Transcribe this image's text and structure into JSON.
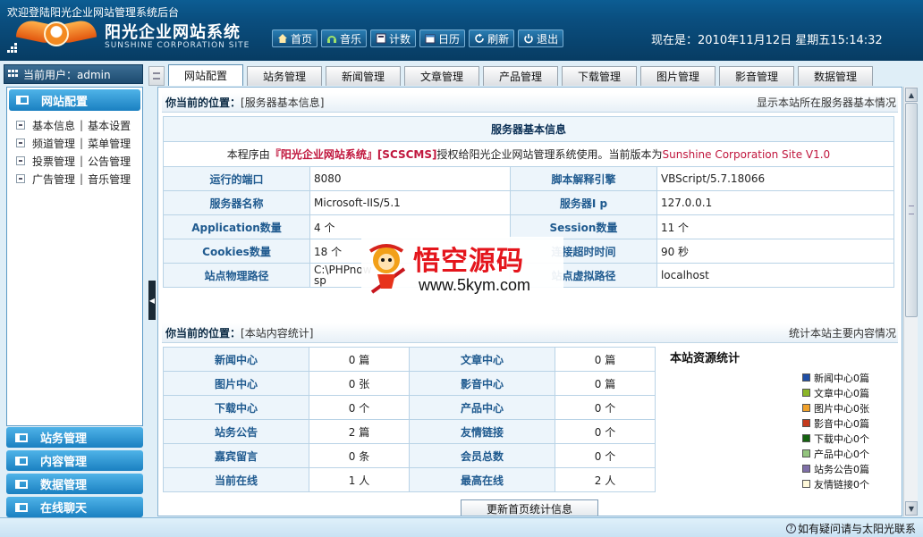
{
  "header": {
    "welcome": "欢迎登陆阳光企业网站管理系统后台",
    "site_title": "阳光企业网站系统",
    "site_subtitle": "SUNSHINE CORPORATION SITE",
    "datetime": "现在是：2010年11月12日 星期五15:14:32",
    "nav": [
      {
        "label": "首页",
        "icon": "home-icon"
      },
      {
        "label": "音乐",
        "icon": "headphones-icon"
      },
      {
        "label": "计数",
        "icon": "counter-icon"
      },
      {
        "label": "日历",
        "icon": "calendar-icon"
      },
      {
        "label": "刷新",
        "icon": "refresh-icon"
      },
      {
        "label": "退出",
        "icon": "power-icon"
      }
    ]
  },
  "sidebar": {
    "current_user": "当前用户：admin",
    "section_title": "网站配置",
    "rows": [
      {
        "a": "基本信息",
        "b": "基本设置"
      },
      {
        "a": "频道管理",
        "b": "菜单管理"
      },
      {
        "a": "投票管理",
        "b": "公告管理"
      },
      {
        "a": "广告管理",
        "b": "音乐管理"
      }
    ],
    "separator": "|",
    "menus": [
      "站务管理",
      "内容管理",
      "数据管理",
      "在线聊天"
    ]
  },
  "tabs": [
    "网站配置",
    "站务管理",
    "新闻管理",
    "文章管理",
    "产品管理",
    "下载管理",
    "图片管理",
    "影音管理",
    "数据管理"
  ],
  "server_section": {
    "location_label": "你当前的位置：",
    "location": "[服务器基本信息]",
    "hint": "显示本站所在服务器基本情况",
    "table_title": "服务器基本信息",
    "notice_prefix": "本程序由",
    "notice_brand": "『阳光企业网站系统』[SCSCMS]",
    "notice_mid": "授权给阳光企业网站管理系统使用。当前版本为",
    "notice_version": "Sunshine Corporation Site V1.0",
    "rows": [
      {
        "l1": "运行的端口",
        "v1": "8080",
        "l2": "脚本解释引擎",
        "v2": "VBScript/5.7.18066"
      },
      {
        "l1": "服务器名称",
        "v1": "Microsoft-IIS/5.1",
        "l2": "服务器I p",
        "v2": "127.0.0.1"
      },
      {
        "l1": "Application数量",
        "v1": "4 个",
        "l2": "Session数量",
        "v2": "11 个"
      },
      {
        "l1": "Cookies数量",
        "v1": "18 个",
        "l2": "连接超时时间",
        "v2": "90 秒"
      },
      {
        "l1": "站点物理路径",
        "v1": "C:\\PHPnow\nsp",
        "l2": "站点虚拟路径",
        "v2": "localhost"
      }
    ]
  },
  "stats_section": {
    "location_label": "你当前的位置：",
    "location": "[本站内容统计]",
    "hint": "统计本站主要内容情况",
    "rows": [
      {
        "l1": "新闻中心",
        "v1": "0 篇",
        "l2": "文章中心",
        "v2": "0 篇"
      },
      {
        "l1": "图片中心",
        "v1": "0 张",
        "l2": "影音中心",
        "v2": "0 篇"
      },
      {
        "l1": "下载中心",
        "v1": "0 个",
        "l2": "产品中心",
        "v2": "0 个"
      },
      {
        "l1": "站务公告",
        "v1": "2 篇",
        "l2": "友情链接",
        "v2": "0 个"
      },
      {
        "l1": "嘉宾留言",
        "v1": "0 条",
        "l2": "会员总数",
        "v2": "0 个"
      },
      {
        "l1": "当前在线",
        "v1": "1 人",
        "l2": "最高在线",
        "v2": "2 人"
      }
    ],
    "update_button": "更新首页统计信息"
  },
  "chart_data": {
    "type": "bar",
    "title": "本站资源统计",
    "categories": [
      "新闻中心",
      "文章中心",
      "图片中心",
      "影音中心",
      "下载中心",
      "产品中心",
      "站务公告",
      "友情链接"
    ],
    "series": [
      {
        "name": "新闻中心0篇",
        "values": [
          0
        ],
        "color": "#1f4fa6"
      },
      {
        "name": "文章中心0篇",
        "values": [
          0
        ],
        "color": "#8bb627"
      },
      {
        "name": "图片中心0张",
        "values": [
          0
        ],
        "color": "#f0a12a"
      },
      {
        "name": "影音中心0篇",
        "values": [
          0
        ],
        "color": "#c43a1c"
      },
      {
        "name": "下载中心0个",
        "values": [
          0
        ],
        "color": "#14620f"
      },
      {
        "name": "产品中心0个",
        "values": [
          0
        ],
        "color": "#93c47d"
      },
      {
        "name": "站务公告0篇",
        "values": [
          0
        ],
        "color": "#7f6fa8"
      },
      {
        "name": "友情链接0个",
        "values": [
          0
        ],
        "color": "#fff9d9"
      }
    ],
    "legend": "right"
  },
  "watermark": {
    "title": "悟空源码",
    "url": "www.5kym.com"
  },
  "footer": {
    "help": "如有疑问请与太阳光联系"
  }
}
